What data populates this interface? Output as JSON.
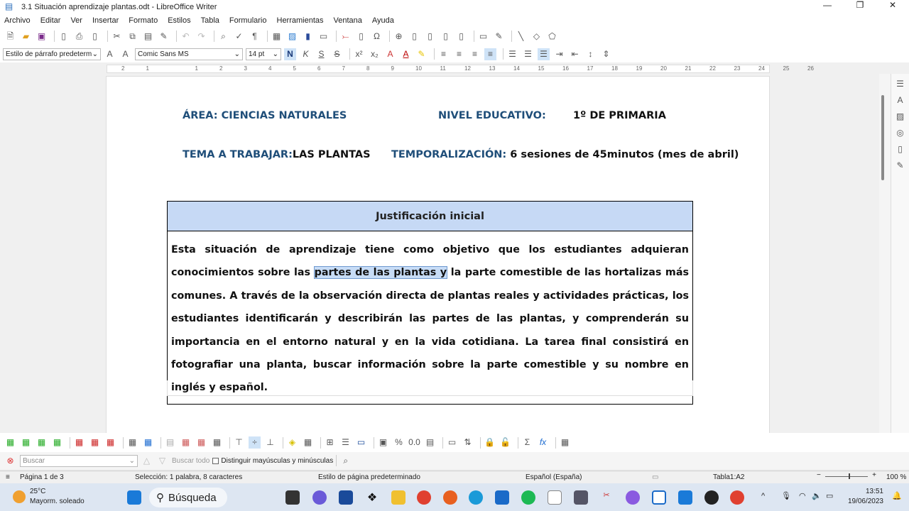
{
  "window": {
    "title": "3.1 Situación aprendizaje plantas.odt - LibreOffice Writer"
  },
  "menu": [
    "Archivo",
    "Editar",
    "Ver",
    "Insertar",
    "Formato",
    "Estilos",
    "Tabla",
    "Formulario",
    "Herramientas",
    "Ventana",
    "Ayuda"
  ],
  "format_bar": {
    "paragraph_style": "Estilo de párrafo predeterm",
    "font": "Comic Sans MS",
    "size": "14 pt",
    "bold": "N",
    "italic": "K",
    "underline": "S",
    "strike": "S"
  },
  "ruler": {
    "ticks": [
      "2",
      "1",
      "1",
      "2",
      "3",
      "4",
      "5",
      "6",
      "7",
      "8",
      "9",
      "10",
      "11",
      "12",
      "13",
      "14",
      "15",
      "16",
      "17",
      "18",
      "19",
      "20",
      "21",
      "22",
      "23",
      "24",
      "25",
      "26"
    ]
  },
  "document": {
    "area_label": "ÁREA: CIENCIAS NATURALES",
    "level_label": "NIVEL EDUCATIVO:",
    "level_value": "1º DE PRIMARIA",
    "topic_label": "TEMA A TRABAJAR:",
    "topic_value": "LAS PLANTAS",
    "time_label": "TEMPORALIZACIÓN:",
    "time_value": "6 sesiones de 45minutos (mes de abril)",
    "table": {
      "header": "Justificación inicial",
      "body_before": "Esta situación de aprendizaje tiene como objetivo que los estudiantes adquieran conocimientos sobre las ",
      "body_selected": "partes de las plantas y",
      "body_after": " la parte comestible de las hortalizas más comunes. A través de la observación directa de plantas reales y actividades prácticas, los estudiantes identificarán y describirán las partes de las plantas, y comprenderán su importancia en el entorno natural y en la vida cotidiana. La tarea final consistirá en fotografiar una planta, buscar información sobre la parte comestible y su nombre en inglés y español."
    }
  },
  "find": {
    "placeholder": "Buscar",
    "find_all": "Buscar todo",
    "match_case": "Distinguir mayúsculas y minúsculas"
  },
  "status": {
    "page": "Página 1 de 3",
    "selection": "Selección: 1 palabra, 8 caracteres",
    "page_style": "Estilo de página predeterminado",
    "language": "Español (España)",
    "cell": "Tabla1:A2",
    "zoom": "100 %"
  },
  "taskbar": {
    "temp": "25°C",
    "weather": "Mayorm. soleado",
    "search": "Búsqueda",
    "time": "13:51",
    "date": "19/06/2023"
  }
}
